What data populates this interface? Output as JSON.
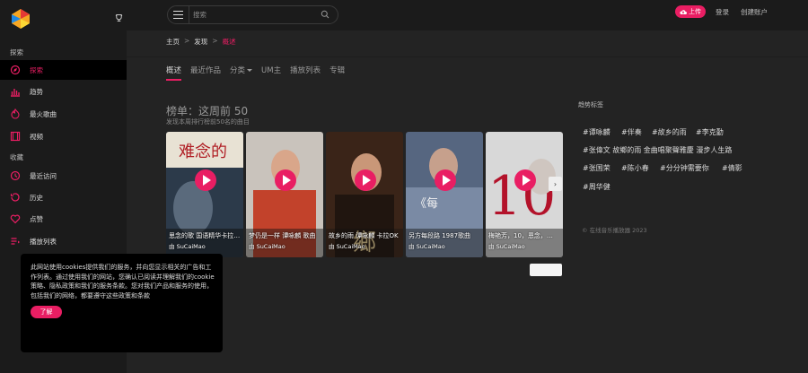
{
  "sidebar": {
    "sections": [
      {
        "label": "探索"
      },
      {
        "label": "收藏"
      }
    ],
    "items": [
      {
        "label": "探索",
        "icon": "compass-icon"
      },
      {
        "label": "趋势",
        "icon": "bar-chart-icon"
      },
      {
        "label": "最火歌曲",
        "icon": "fire-icon"
      },
      {
        "label": "视频",
        "icon": "film-icon"
      },
      {
        "label": "最近访问",
        "icon": "clock-icon"
      },
      {
        "label": "历史",
        "icon": "history-icon"
      },
      {
        "label": "点赞",
        "icon": "heart-icon"
      },
      {
        "label": "播放列表",
        "icon": "playlist-icon"
      }
    ]
  },
  "topbar": {
    "search_placeholder": "搜索",
    "upload_label": "上传",
    "login_label": "登录",
    "register_label": "创建账户"
  },
  "breadcrumb": [
    "主页",
    "发现",
    "概述"
  ],
  "tabs": [
    "概述",
    "最近作品",
    "分类",
    "UM主",
    "播放列表",
    "专辑"
  ],
  "chart": {
    "title": "榜单：这周前 50",
    "subtitle": "发现本周排行榜前50名的曲目",
    "cards": [
      {
        "title": "思念的歌 国语精华卡拉OK",
        "artist": "由 SuCaiMao"
      },
      {
        "title": "梦仍是一样 谭咏麟 歌曲",
        "artist": "由 SuCaiMao"
      },
      {
        "title": "故乡的雨 谭咏麟 卡拉OK",
        "artist": "由 SuCaiMao"
      },
      {
        "title": "另方每段路 1987歌曲",
        "artist": "由 SuCaiMao"
      },
      {
        "title": "梅艳芳，10，恩念，…",
        "artist": "由 SuCaiMao"
      }
    ]
  },
  "trending": {
    "title": "趋势标签",
    "tags": [
      "#谭咏麟",
      "#伴奏",
      "#故乡的雨",
      "#李克勤",
      "#张偉文 故鄉的雨 金曲唱聚聲雅慶 漫步人生路",
      "#张国荣",
      "#陈小春",
      "#分分钟需要你",
      "#倩影",
      "#周华健"
    ]
  },
  "copyright": "© 在线音乐播放器 2023",
  "cookie": {
    "text": "此网站使用cookies提供我们的服务，并向您显示相关的广告和工作列表。通过使用我们的网站，您确认已阅读并理解我们的cookie策略、隐私政策和我们的服务条款。您对我们产品和服务的使用，包括我们的网络，都要遵守这些政策和条款",
    "button": "了解"
  },
  "colors": {
    "accent": "#e91e63",
    "bg": "#232323",
    "sidebar": "#1b1b1b"
  }
}
